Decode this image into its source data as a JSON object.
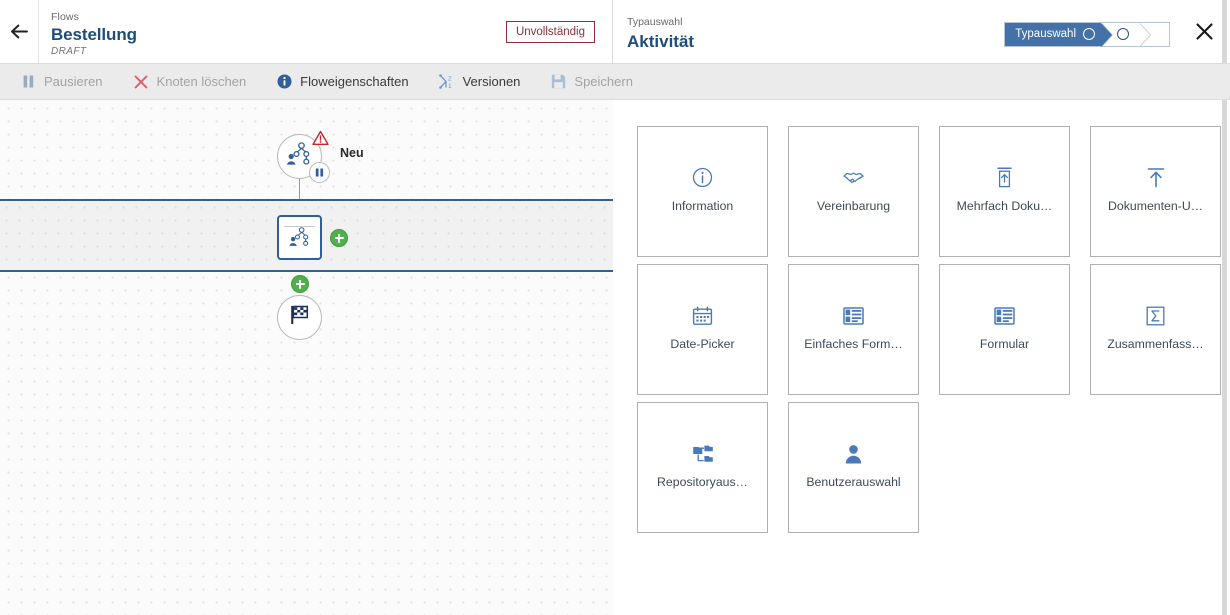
{
  "left": {
    "back_icon": "arrow-left-icon",
    "breadcrumb": "Flows",
    "title": "Bestellung",
    "subtitle": "DRAFT",
    "status_badge": "Unvollständig",
    "status_badge_color": "#8c2f39"
  },
  "toolbar": {
    "items": [
      {
        "label": "Pausieren",
        "icon": "pause-icon",
        "enabled": false
      },
      {
        "label": "Knoten löschen",
        "icon": "close-x-icon",
        "enabled": false
      },
      {
        "label": "Floweigenschaften",
        "icon": "info-icon",
        "enabled": true
      },
      {
        "label": "Versionen",
        "icon": "versions-icon",
        "enabled": true
      },
      {
        "label": "Speichern",
        "icon": "save-disk-icon",
        "enabled": false
      }
    ]
  },
  "canvas": {
    "nodes": [
      {
        "id": "start",
        "label": "Neu",
        "shape": "circle",
        "icon": "process-users-icon",
        "badges": [
          "warning-triangle-icon",
          "pause-icon"
        ]
      },
      {
        "id": "activity",
        "label": "",
        "shape": "rect",
        "icon": "process-users-icon",
        "selected": true
      },
      {
        "id": "end",
        "label": "",
        "shape": "circle",
        "icon": "checkered-flag-icon"
      }
    ],
    "add_buttons": 2,
    "lane_highlight_color": "#355f8c"
  },
  "right": {
    "breadcrumb": "Typauswahl",
    "title": "Aktivität",
    "close_icon": "close-icon",
    "wizard": {
      "steps": [
        {
          "label": "Typauswahl",
          "state": "active"
        },
        {
          "label": "",
          "state": "pending"
        },
        {
          "label": "",
          "state": "blank"
        }
      ],
      "active_color": "#4472a8"
    },
    "cards": [
      {
        "label": "Information",
        "icon": "info-circle-icon"
      },
      {
        "label": "Vereinbarung",
        "icon": "handshake-icon"
      },
      {
        "label": "Mehrfach Doku…",
        "icon": "multi-upload-icon"
      },
      {
        "label": "Dokumenten-U…",
        "icon": "upload-arrow-icon"
      },
      {
        "label": "Date-Picker",
        "icon": "calendar-icon"
      },
      {
        "label": "Einfaches Form…",
        "icon": "form-simple-icon"
      },
      {
        "label": "Formular",
        "icon": "form-icon"
      },
      {
        "label": "Zusammenfass…",
        "icon": "sigma-box-icon"
      },
      {
        "label": "Repositoryaus…",
        "icon": "repository-tree-icon"
      },
      {
        "label": "Benutzerauswahl",
        "icon": "user-icon"
      }
    ]
  }
}
